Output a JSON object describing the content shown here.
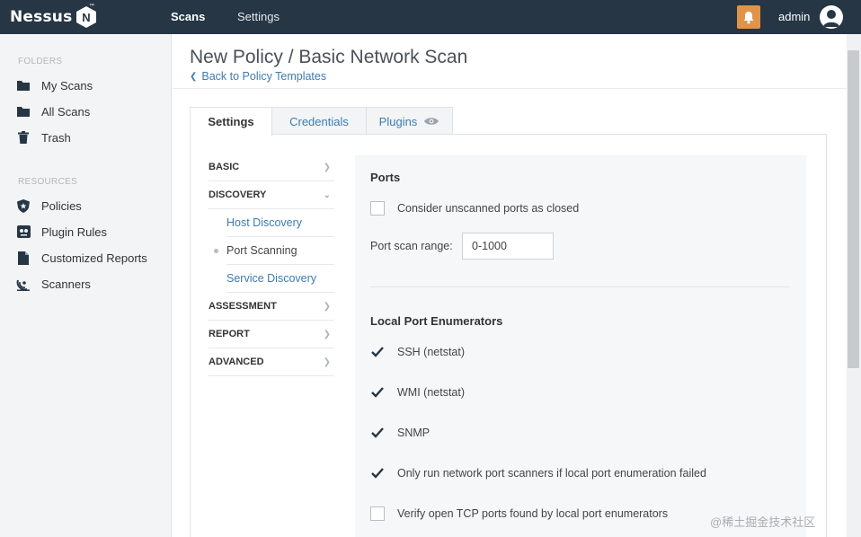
{
  "app": {
    "brand": "Nessus",
    "brand_mark": "N"
  },
  "topnav": {
    "scans": "Scans",
    "settings": "Settings"
  },
  "user": {
    "name": "admin"
  },
  "sidebar": {
    "folders_heading": "FOLDERS",
    "folders": [
      {
        "label": "My Scans",
        "icon": "folder-icon"
      },
      {
        "label": "All Scans",
        "icon": "folder-icon"
      },
      {
        "label": "Trash",
        "icon": "trash-icon"
      }
    ],
    "resources_heading": "RESOURCES",
    "resources": [
      {
        "label": "Policies",
        "icon": "shield-icon"
      },
      {
        "label": "Plugin Rules",
        "icon": "plugin-rules-icon"
      },
      {
        "label": "Customized Reports",
        "icon": "report-icon"
      },
      {
        "label": "Scanners",
        "icon": "scanner-icon"
      }
    ]
  },
  "page": {
    "title": "New Policy / Basic Network Scan",
    "back_link": "Back to Policy Templates"
  },
  "tabs": [
    {
      "label": "Settings",
      "active": true
    },
    {
      "label": "Credentials",
      "active": false
    },
    {
      "label": "Plugins",
      "active": false
    }
  ],
  "settings_nav": {
    "basic": "BASIC",
    "discovery": "DISCOVERY",
    "discovery_items": [
      "Host Discovery",
      "Port Scanning",
      "Service Discovery"
    ],
    "current": "Port Scanning",
    "assessment": "ASSESSMENT",
    "report": "REPORT",
    "advanced": "ADVANCED"
  },
  "ports": {
    "title": "Ports",
    "consider_unscanned": {
      "label": "Consider unscanned ports as closed",
      "checked": false
    },
    "range_label": "Port scan range:",
    "range_value": "0-1000"
  },
  "enumerators": {
    "title": "Local Port Enumerators",
    "items": [
      {
        "label": "SSH (netstat)",
        "checked": true
      },
      {
        "label": "WMI (netstat)",
        "checked": true
      },
      {
        "label": "SNMP",
        "checked": true
      },
      {
        "label": "Only run network port scanners if local port enumeration failed",
        "checked": true
      },
      {
        "label": "Verify open TCP ports found by local port enumerators",
        "checked": false
      }
    ]
  },
  "watermark": "@稀土掘金技术社区",
  "colors": {
    "topbar": "#263645",
    "accent": "#3f7bb0",
    "bell": "#e0944a"
  }
}
